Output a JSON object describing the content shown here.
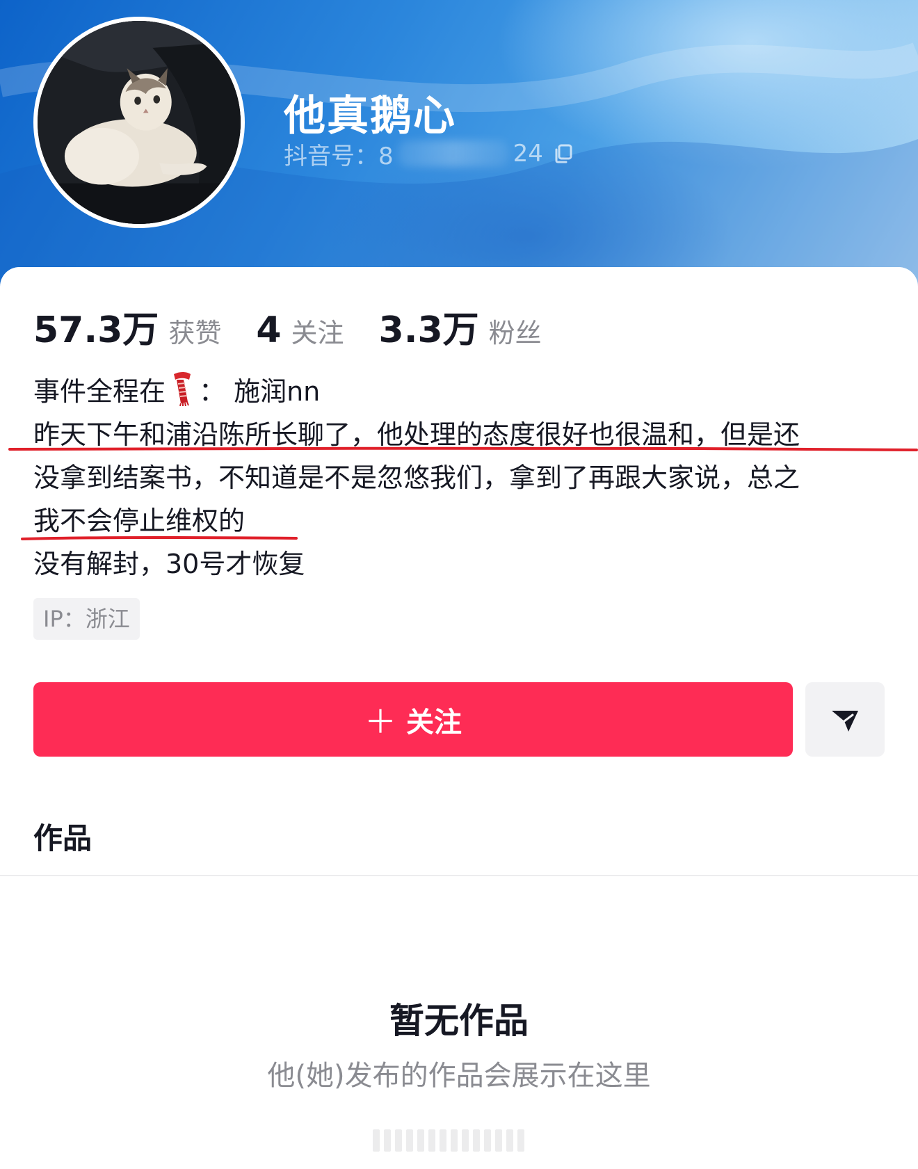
{
  "profile": {
    "nickname": "他真鹅心",
    "account_prefix": "抖音号：8",
    "account_suffix": "24",
    "avatar": "cat-photo",
    "copy_icon": "copy-icon"
  },
  "stats": [
    {
      "value": "57.3万",
      "label": "获赞"
    },
    {
      "value": "4",
      "label": "关注"
    },
    {
      "value": "3.3万",
      "label": "粉丝"
    }
  ],
  "bio": {
    "line1_prefix": "事件全程在",
    "line1_emoji": "scarf-emoji",
    "line1_suffix": "： 施润nn",
    "line2": "昨天下午和浦沿陈所长聊了，他处理的态度很好也很温和，但是还",
    "line3": "没拿到结案书，不知道是不是忽悠我们，拿到了再跟大家说，总之",
    "line4": "我不会停止维权的",
    "line5": "没有解封，30号才恢复"
  },
  "ip_tag": "IP：浙江",
  "actions": {
    "follow_label": "关注",
    "follow_icon": "plus-icon",
    "share_icon": "send-icon"
  },
  "works": {
    "tab_label": "作品",
    "empty_title": "暂无作品",
    "empty_subtitle": "他(她)发布的作品会展示在这里"
  },
  "colors": {
    "accent": "#fe2c55",
    "banner": "#2b86dc",
    "annotation": "#e0202a"
  }
}
